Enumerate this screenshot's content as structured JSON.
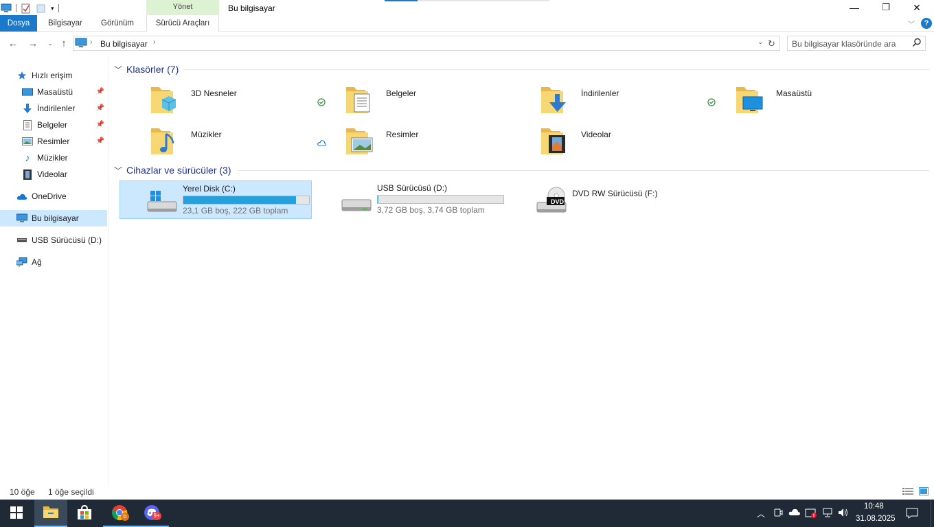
{
  "window": {
    "title": "Bu bilgisayar",
    "context_group": "Yönet",
    "minimize_glyph": "—",
    "maximize_glyph": "❐",
    "close_glyph": "✕"
  },
  "ribbon": {
    "tabs": [
      "Dosya",
      "Bilgisayar",
      "Görünüm",
      "Sürücü Araçları"
    ]
  },
  "address": {
    "segments": [
      "Bu bilgisayar"
    ],
    "search_placeholder": "Bu bilgisayar klasöründe ara"
  },
  "nav": {
    "items": [
      {
        "label": "Hızlı erişim",
        "icon": "star-icon"
      },
      {
        "label": "Masaüstü",
        "icon": "desktop-icon",
        "pinned": true
      },
      {
        "label": "İndirilenler",
        "icon": "download-icon",
        "pinned": true
      },
      {
        "label": "Belgeler",
        "icon": "documents-icon",
        "pinned": true
      },
      {
        "label": "Resimler",
        "icon": "pictures-icon",
        "pinned": true
      },
      {
        "label": "Müzikler",
        "icon": "music-icon"
      },
      {
        "label": "Videolar",
        "icon": "videos-icon"
      },
      {
        "label": "OneDrive",
        "icon": "cloud-icon"
      },
      {
        "label": "Bu bilgisayar",
        "icon": "computer-icon",
        "selected": true
      },
      {
        "label": "USB Sürücüsü (D:)",
        "icon": "usb-drive-icon"
      },
      {
        "label": "Ağ",
        "icon": "network-icon"
      }
    ]
  },
  "content": {
    "folders_header": "Klasörler (7)",
    "devices_header": "Cihazlar ve sürücüler (3)",
    "folders": [
      {
        "name": "3D Nesneler",
        "status": "synced"
      },
      {
        "name": "Belgeler",
        "status": ""
      },
      {
        "name": "İndirilenler",
        "status": "synced"
      },
      {
        "name": "Masaüstü",
        "status": ""
      },
      {
        "name": "Müzikler",
        "status": "cloud"
      },
      {
        "name": "Resimler",
        "status": ""
      },
      {
        "name": "Videolar",
        "status": ""
      }
    ],
    "drives": [
      {
        "name": "Yerel Disk (C:)",
        "detail": "23,1 GB boş, 222 GB toplam",
        "used_fraction": 0.896,
        "selected": true
      },
      {
        "name": "USB Sürücüsü (D:)",
        "detail": "3,72 GB boş, 3,74 GB toplam",
        "used_fraction": 0.005,
        "selected": false
      },
      {
        "name": "DVD RW Sürücüsü (F:)",
        "detail": "",
        "dvd_label": "DVD"
      }
    ]
  },
  "status": {
    "item_count": "10 öğe",
    "selected_count": "1 öğe seçildi"
  },
  "taskbar": {
    "time": "10:48",
    "date": "31.08.2025",
    "chrome_badge": "b",
    "discord_badge": "9+"
  },
  "colors": {
    "accent": "#1979ca",
    "selection": "#cce8ff",
    "group_header": "#1e3287",
    "drive_fill": "#26a0da",
    "taskbar": "#1f2a36"
  }
}
